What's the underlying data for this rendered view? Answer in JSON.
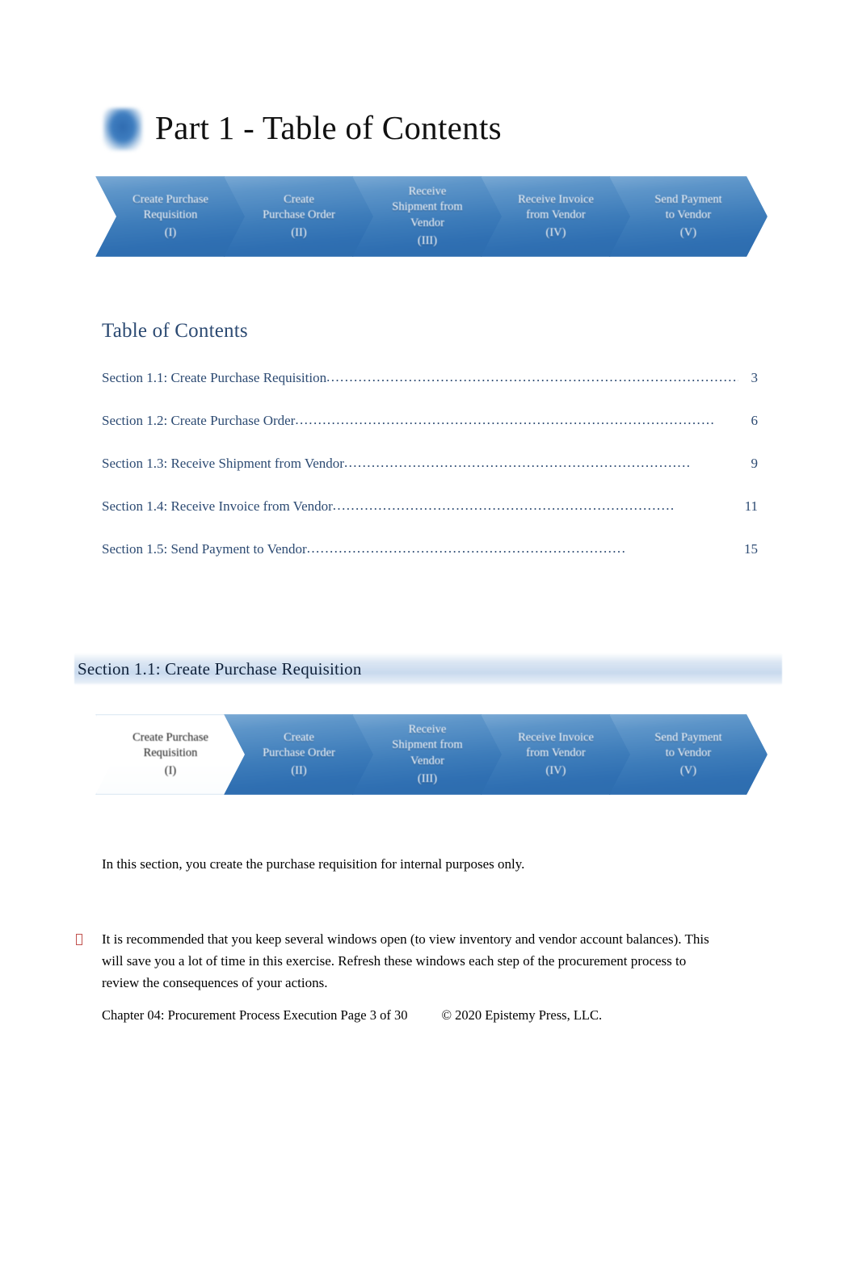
{
  "document": {
    "title": "Part 1 - Table of Contents",
    "title_mark_icon": "blue-rounded-square-icon",
    "accent_color": "#2c4a72",
    "chevron_blue": "#3d7cba",
    "band_blue": "#c9daee",
    "bullet_color": "#c0504d"
  },
  "process_top": {
    "steps": [
      {
        "label": "Create Purchase\nRequisition",
        "line1": "Create Purchase",
        "line2": "Requisition",
        "roman": "(I)",
        "active": false
      },
      {
        "label": "Create\nPurchase Order",
        "line1": "Create",
        "line2": "Purchase Order",
        "roman": "(II)",
        "active": false
      },
      {
        "label": "Receive\nShipment from\nVendor",
        "line1": "Receive",
        "line2": "Shipment from",
        "line3": "Vendor",
        "roman": "(III)",
        "active": false
      },
      {
        "label": "Receive Invoice\nfrom Vendor",
        "line1": "Receive Invoice",
        "line2": "from Vendor",
        "roman": "(IV)",
        "active": false
      },
      {
        "label": "Send Payment\nto Vendor",
        "line1": "Send Payment",
        "line2": "to Vendor",
        "roman": "(V)",
        "active": false
      }
    ]
  },
  "process_section": {
    "steps": [
      {
        "line1": "Create Purchase",
        "line2": "Requisition",
        "roman": "(I)",
        "active": true
      },
      {
        "line1": "Create",
        "line2": "Purchase Order",
        "roman": "(II)",
        "active": false
      },
      {
        "line1": "Receive",
        "line2": "Shipment from",
        "line3": "Vendor",
        "roman": "(III)",
        "active": false
      },
      {
        "line1": "Receive Invoice",
        "line2": "from Vendor",
        "roman": "(IV)",
        "active": false
      },
      {
        "line1": "Send Payment",
        "line2": "to Vendor",
        "roman": "(V)",
        "active": false
      }
    ]
  },
  "toc": {
    "heading": "Table of Contents",
    "entries": [
      {
        "text": "Section 1.1: Create Purchase Requisition",
        "page": "3",
        "dots": "..............................................................................................."
      },
      {
        "text": "Section 1.2: Create Purchase Order",
        "page": "6",
        "dots": "............................................................................................"
      },
      {
        "text": "Section 1.3: Receive Shipment from Vendor",
        "page": "9",
        "dots": "............................................................................"
      },
      {
        "text": "Section 1.4: Receive Invoice from Vendor",
        "page": "11",
        "dots": "..........................................................................."
      },
      {
        "text": "Section 1.5: Send Payment to Vendor ",
        "page": "15",
        "dots": "......................................................................"
      }
    ]
  },
  "section": {
    "heading": "Section 1.1: Create Purchase Requisition",
    "intro": "In this section, you create the purchase requisition for internal purposes only.",
    "note_bullet_glyph": "missing-glyph-box",
    "note": "It is recommended that you keep several windows open (to view inventory and vendor account balances). This will save you a lot of time in this exercise. Refresh these windows each step of the procurement process to review the consequences of your actions."
  },
  "footer": {
    "left": "Chapter 04: Procurement Process Execution Page 3 of 30",
    "right": "© 2020 Epistemy Press, LLC."
  }
}
